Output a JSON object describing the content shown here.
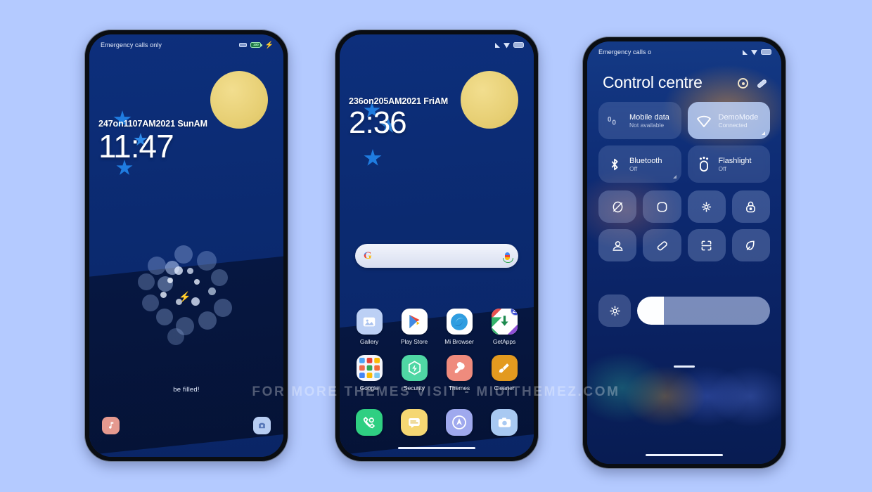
{
  "background_color": "#b4caff",
  "watermark": "FOR MORE THEMES VISIT - MIUITHEMEZ.COM",
  "lockscreen": {
    "status": {
      "carrier": "Emergency calls only",
      "battery_level": "100",
      "icons": [
        "battery-small-icon",
        "battery-icon",
        "charging-bolt-icon"
      ]
    },
    "clock": {
      "meta": "247on1107AM2021 SunAM",
      "time": "11:47"
    },
    "charging_text": "be filled!",
    "shortcuts": {
      "music_label": "music-shortcut",
      "camera_label": "camera-shortcut"
    }
  },
  "homescreen": {
    "status": {
      "icons": [
        "signal-icon",
        "wifi-icon",
        "battery-icon"
      ]
    },
    "clock": {
      "meta": "236on205AM2021 FriAM",
      "time": "2:36"
    },
    "search": {
      "placeholder": "",
      "value": "",
      "logo": "google-g-icon",
      "mic": "microphone-icon"
    },
    "apps": [
      {
        "label": "Gallery",
        "icon": "gallery-icon",
        "badge": ""
      },
      {
        "label": "Play Store",
        "icon": "play-store-icon",
        "badge": ""
      },
      {
        "label": "Mi Browser",
        "icon": "mi-browser-icon",
        "badge": ""
      },
      {
        "label": "GetApps",
        "icon": "getapps-icon",
        "badge": "21"
      },
      {
        "label": "Google",
        "icon": "google-folder-icon",
        "badge": ""
      },
      {
        "label": "Security",
        "icon": "security-icon",
        "badge": ""
      },
      {
        "label": "Themes",
        "icon": "themes-icon",
        "badge": ""
      },
      {
        "label": "Cleaner",
        "icon": "cleaner-icon",
        "badge": ""
      }
    ],
    "dock": [
      {
        "label": "Phone",
        "icon": "phone-icon"
      },
      {
        "label": "Messages",
        "icon": "messages-icon"
      },
      {
        "label": "Browser",
        "icon": "compass-icon"
      },
      {
        "label": "Camera",
        "icon": "camera-icon"
      }
    ]
  },
  "control_centre": {
    "status": {
      "carrier": "Emergency calls o",
      "icons": [
        "signal-icon",
        "wifi-icon",
        "battery-icon"
      ]
    },
    "title": "Control centre",
    "actions": [
      {
        "name": "settings-icon"
      },
      {
        "name": "edit-pencil-icon"
      }
    ],
    "big_tiles": [
      {
        "title": "Mobile data",
        "subtitle": "Not available",
        "icon": "mobile-data-icon",
        "on": false
      },
      {
        "title": "DemoMode",
        "subtitle": "Connected",
        "icon": "wifi-tile-icon",
        "on": true
      },
      {
        "title": "Bluetooth",
        "subtitle": "Off",
        "icon": "bluetooth-icon",
        "on": false
      },
      {
        "title": "Flashlight",
        "subtitle": "Off",
        "icon": "flashlight-icon",
        "on": false
      }
    ],
    "quick_tiles": [
      {
        "icon": "silent-mode-icon"
      },
      {
        "icon": "screen-record-icon"
      },
      {
        "icon": "cast-icon"
      },
      {
        "icon": "lock-icon"
      },
      {
        "icon": "location-icon"
      },
      {
        "icon": "eraser-icon"
      },
      {
        "icon": "scan-qr-icon"
      },
      {
        "icon": "leaf-icon"
      }
    ],
    "brightness": {
      "auto_icon": "auto-brightness-icon",
      "level_percent": 20
    }
  }
}
